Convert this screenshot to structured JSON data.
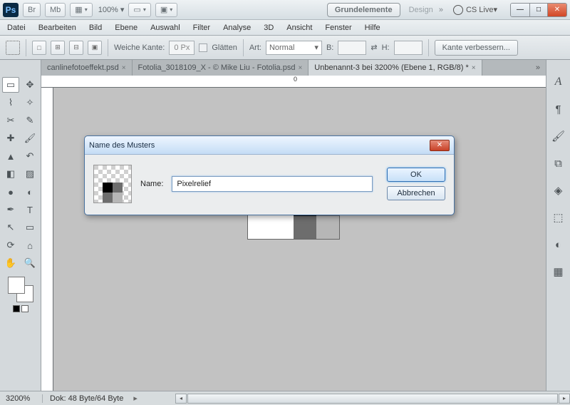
{
  "titlebar": {
    "app": "Ps",
    "br": "Br",
    "mb": "Mb",
    "zoom": "100%",
    "essentials": "Grundelemente",
    "design": "Design",
    "cslive": "CS Live"
  },
  "menu": {
    "items": [
      "Datei",
      "Bearbeiten",
      "Bild",
      "Ebene",
      "Auswahl",
      "Filter",
      "Analyse",
      "3D",
      "Ansicht",
      "Fenster",
      "Hilfe"
    ]
  },
  "options": {
    "feather_label": "Weiche Kante:",
    "feather_value": "0 Px",
    "antialias_label": "Glätten",
    "style_label": "Art:",
    "style_value": "Normal",
    "width_label": "B:",
    "height_label": "H:",
    "refine": "Kante verbessern..."
  },
  "tabs": {
    "t0": "canlinefotoeffekt.psd",
    "t1": "Fotolia_3018109_X - © Mike Liu - Fotolia.psd",
    "t2": "Unbenannt-3 bei 3200% (Ebene 1, RGB/8) *"
  },
  "ruler": {
    "origin": "0"
  },
  "dialog": {
    "title": "Name des Musters",
    "name_label": "Name:",
    "name_value": "Pixelrelief",
    "ok": "OK",
    "cancel": "Abbrechen"
  },
  "status": {
    "zoom": "3200%",
    "doc": "Dok: 48 Byte/64 Byte"
  }
}
